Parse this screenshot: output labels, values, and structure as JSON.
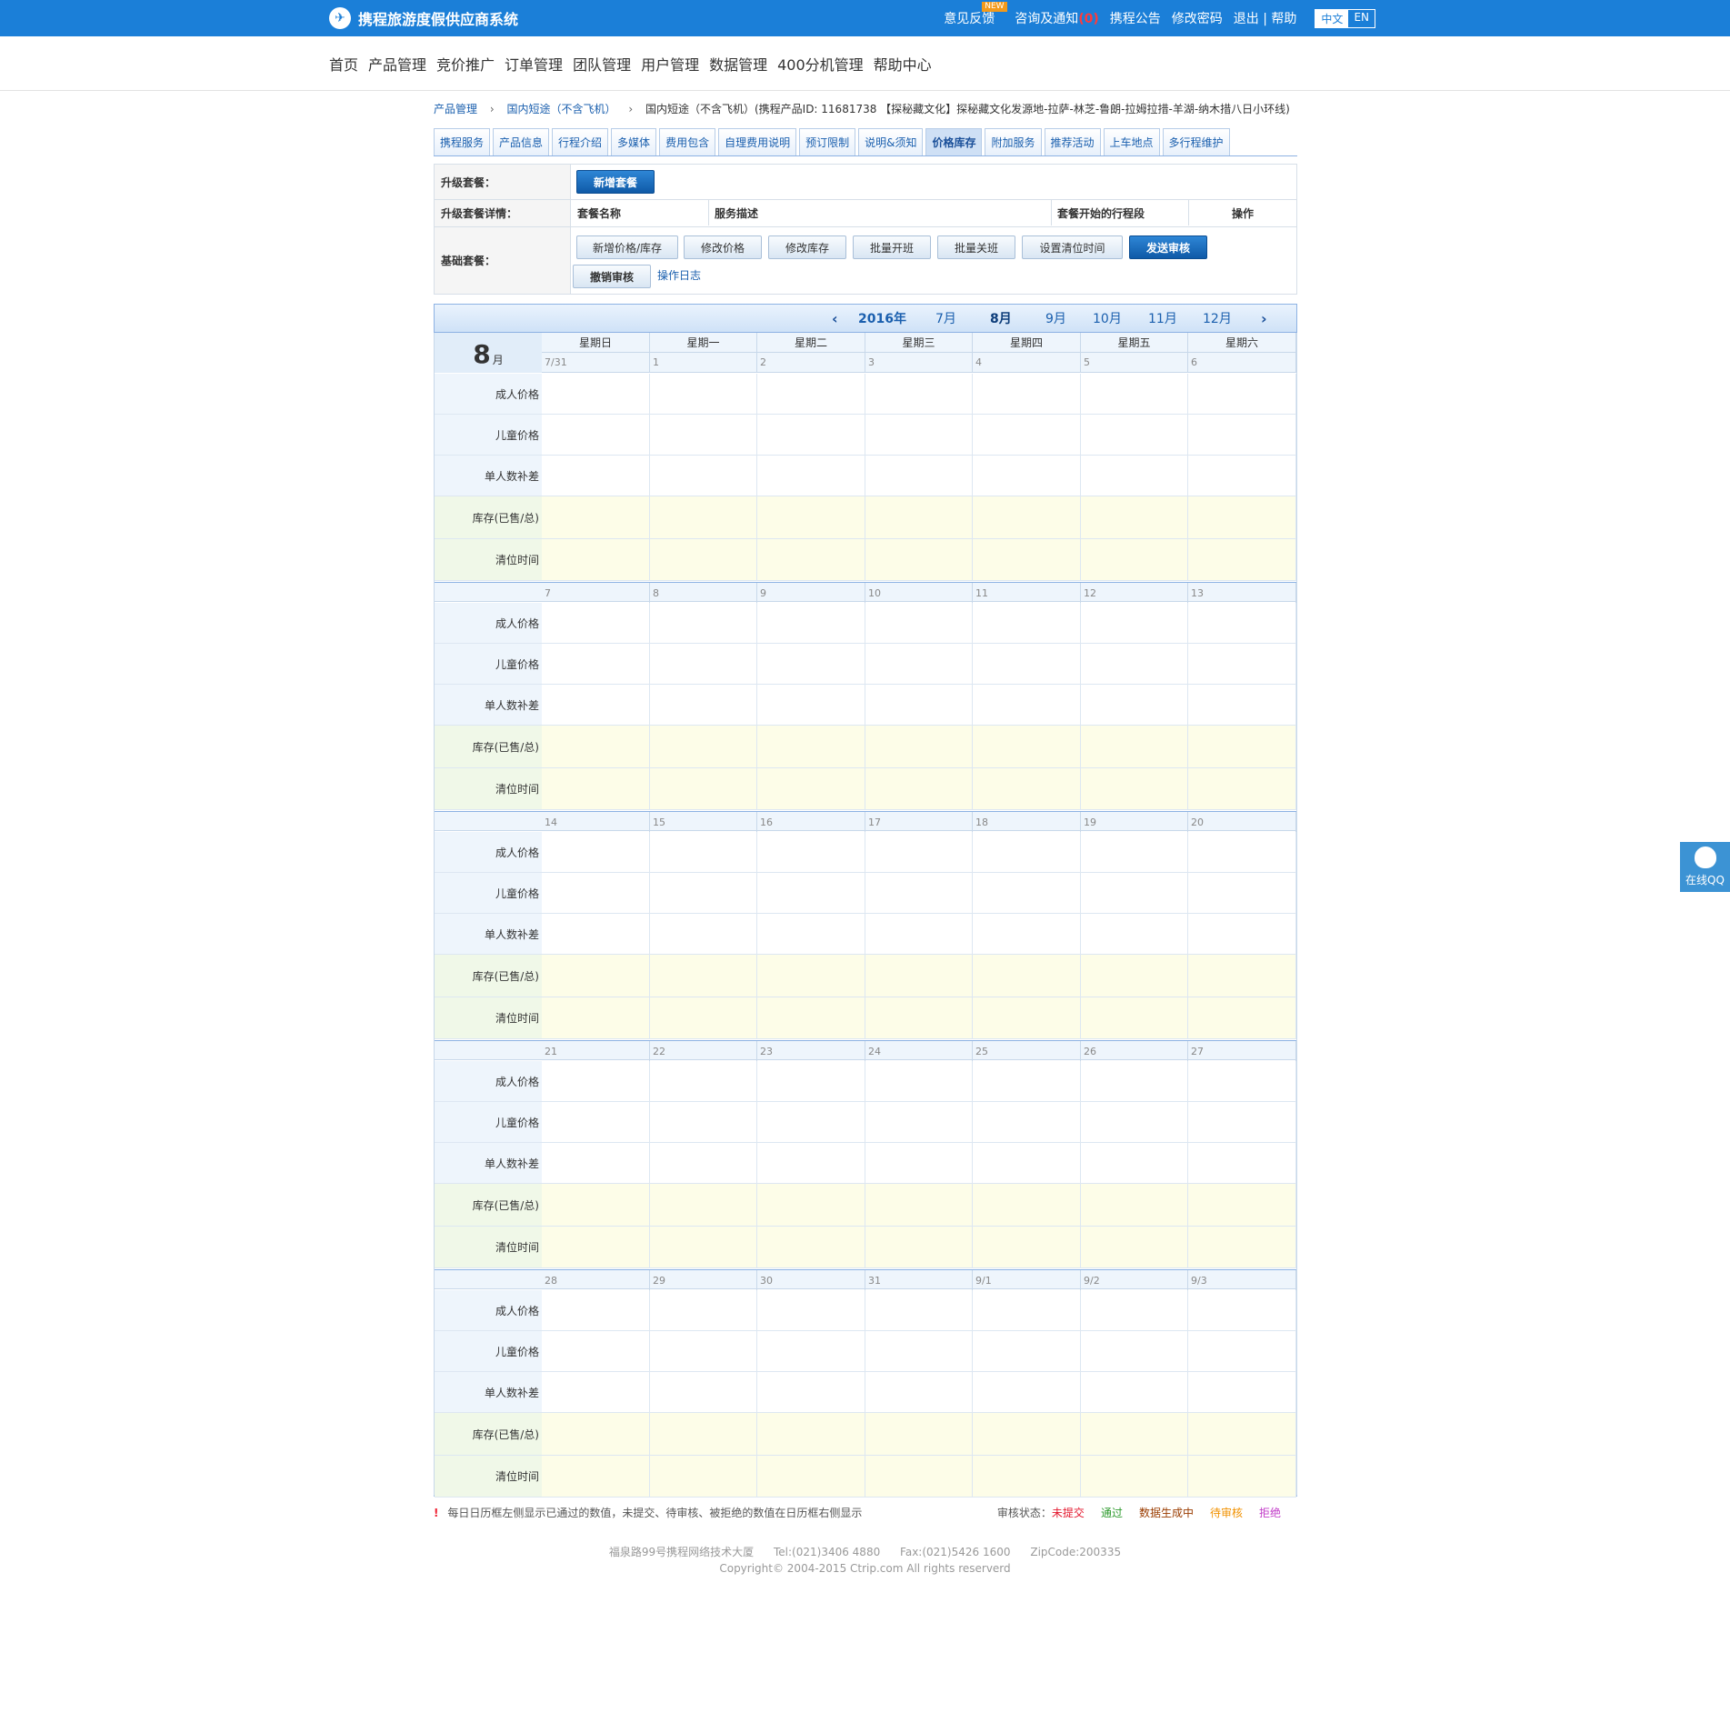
{
  "header": {
    "site_title": "携程旅游度假供应商系统",
    "links": [
      {
        "label": "意见反馈",
        "badge": "NEW"
      },
      {
        "label": "咨询及通知",
        "count": "(0)"
      },
      {
        "label": "携程公告"
      },
      {
        "label": "修改密码"
      },
      {
        "label": "退出 | 帮助"
      }
    ],
    "lang_zh": "中文",
    "lang_en": "EN"
  },
  "nav": [
    "首页",
    "产品管理",
    "竞价推广",
    "订单管理",
    "团队管理",
    "用户管理",
    "数据管理",
    "400分机管理",
    "帮助中心"
  ],
  "breadcrumb": {
    "c1": "产品管理",
    "c2": "国内短途（不含飞机）",
    "c3": "国内短途（不含飞机）(携程产品ID: 11681738 【探秘藏文化】探秘藏文化发源地-拉萨-林芝-鲁朗-拉姆拉措-羊湖-纳木措八日小环线)"
  },
  "tabs": [
    {
      "label": "携程服务"
    },
    {
      "label": "产品信息"
    },
    {
      "label": "行程介绍"
    },
    {
      "label": "多媒体"
    },
    {
      "label": "费用包含"
    },
    {
      "label": "自理费用说明"
    },
    {
      "label": "预订限制"
    },
    {
      "label": "说明&须知"
    },
    {
      "label": "价格库存",
      "active": true
    },
    {
      "label": "附加服务"
    },
    {
      "label": "推荐活动"
    },
    {
      "label": "上车地点"
    },
    {
      "label": "多行程维护"
    }
  ],
  "package": {
    "upgrade_label": "升级套餐：",
    "add_package": "新增套餐",
    "detail_label": "升级套餐详情：",
    "col_name": "套餐名称",
    "col_desc": "服务描述",
    "col_start": "套餐开始的行程段",
    "col_op": "操作",
    "basic_label": "基础套餐：",
    "btn_add_price": "新增价格/库存",
    "btn_edit_price": "修改价格",
    "btn_edit_stock": "修改库存",
    "btn_batch_open": "批量开班",
    "btn_batch_close": "批量关班",
    "btn_clear_time": "设置清位时间",
    "btn_submit": "发送审核",
    "btn_cancel": "撤销审核",
    "log": "操作日志"
  },
  "calendar": {
    "year": "2016年",
    "months": [
      "7月",
      "8月",
      "9月",
      "10月",
      "11月",
      "12月"
    ],
    "current_month": "8月",
    "month_num": "8",
    "month_unit": "月",
    "weekdays": [
      "星期日",
      "星期一",
      "星期二",
      "星期三",
      "星期四",
      "星期五",
      "星期六"
    ],
    "row_labels": [
      "成人价格",
      "儿童价格",
      "单人数补差",
      "库存(已售/总)",
      "清位时间"
    ],
    "weeks": [
      [
        "7/31",
        "1",
        "2",
        "3",
        "4",
        "5",
        "6"
      ],
      [
        "7",
        "8",
        "9",
        "10",
        "11",
        "12",
        "13"
      ],
      [
        "14",
        "15",
        "16",
        "17",
        "18",
        "19",
        "20"
      ],
      [
        "21",
        "22",
        "23",
        "24",
        "25",
        "26",
        "27"
      ],
      [
        "28",
        "29",
        "30",
        "31",
        "9/1",
        "9/2",
        "9/3"
      ]
    ],
    "colors": {
      "row_bg": "#ffffff",
      "stock_bg": "#fdfde8",
      "label_bg": "#eef5fc",
      "stock_label_bg": "#f0f8e8"
    }
  },
  "legend": {
    "warn_icon": "!",
    "note": "每日日历框左侧显示已通过的数值，未提交、待审核、被拒绝的数值在日历框右侧显示",
    "status_label": "审核状态：",
    "status": [
      {
        "label": "未提交",
        "color": "#e3172d"
      },
      {
        "label": "通过",
        "color": "#2d9a2d"
      },
      {
        "label": "数据生成中",
        "color": "#9a3c00"
      },
      {
        "label": "待审核",
        "color": "#f19100"
      },
      {
        "label": "拒绝",
        "color": "#c13bc8"
      }
    ]
  },
  "footer": {
    "address": "福泉路99号携程网络技术大厦",
    "tel": "Tel:(021)3406 4880",
    "fax": "Fax:(021)5426 1600",
    "zip": "ZipCode:200335",
    "copyright": "Copyright© 2004-2015 Ctrip.com All rights reserverd"
  },
  "qq": {
    "label": "在线QQ"
  }
}
